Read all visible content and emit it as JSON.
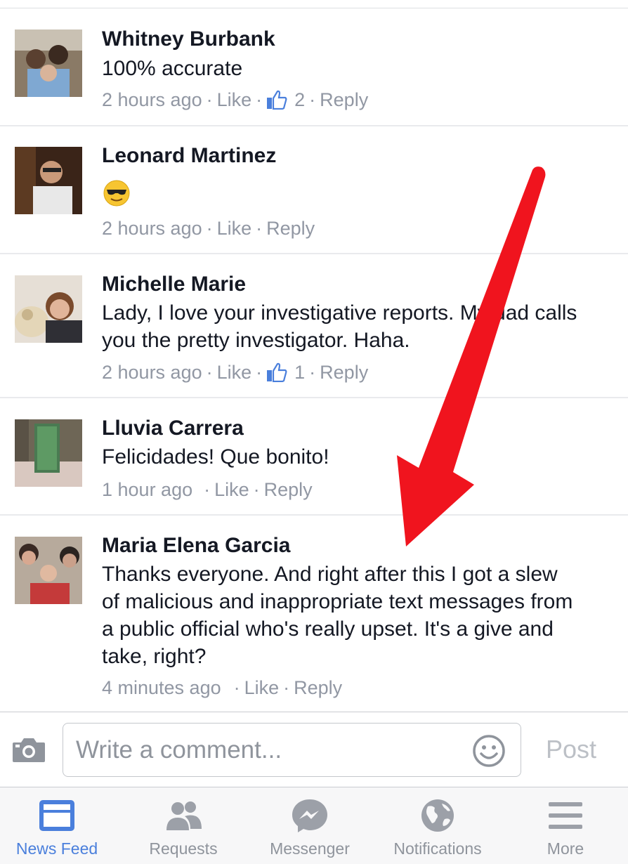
{
  "comments": [
    {
      "author": "Whitney Burbank",
      "text": "100% accurate",
      "time": "2 hours ago",
      "like": "Like",
      "like_count": "2",
      "reply": "Reply"
    },
    {
      "author": "Leonard Martinez",
      "text": "😎",
      "time": "2 hours ago",
      "like": "Like",
      "reply": "Reply"
    },
    {
      "author": "Michelle Marie",
      "text": "Lady, I love your investigative reports. My dad calls you the pretty investigator. Haha.",
      "time": "2 hours ago",
      "like": "Like",
      "like_count": "1",
      "reply": "Reply"
    },
    {
      "author": "Lluvia Carrera",
      "text": "Felicidades! Que bonito!",
      "time": "1 hour ago",
      "like": "Like",
      "reply": "Reply"
    },
    {
      "author": "Maria Elena Garcia",
      "text": "Thanks everyone. And right after this I got a slew of malicious and inappropriate text messages from a public official who's really upset. It's a give and take, right?",
      "time": "4 minutes ago",
      "like": "Like",
      "reply": "Reply"
    }
  ],
  "composer": {
    "placeholder": "Write a comment...",
    "post_label": "Post",
    "camera_icon": "camera-icon",
    "emoji_icon": "smiley-icon"
  },
  "tabbar": {
    "items": [
      {
        "label": "News Feed",
        "icon": "news-feed-icon",
        "active": true
      },
      {
        "label": "Requests",
        "icon": "requests-icon",
        "active": false
      },
      {
        "label": "Messenger",
        "icon": "messenger-icon",
        "active": false
      },
      {
        "label": "Notifications",
        "icon": "globe-icon",
        "active": false
      },
      {
        "label": "More",
        "icon": "menu-icon",
        "active": false
      }
    ]
  },
  "colors": {
    "accent": "#4a7fdc",
    "meta_text": "#9197a3",
    "arrow": "#f0141e"
  }
}
